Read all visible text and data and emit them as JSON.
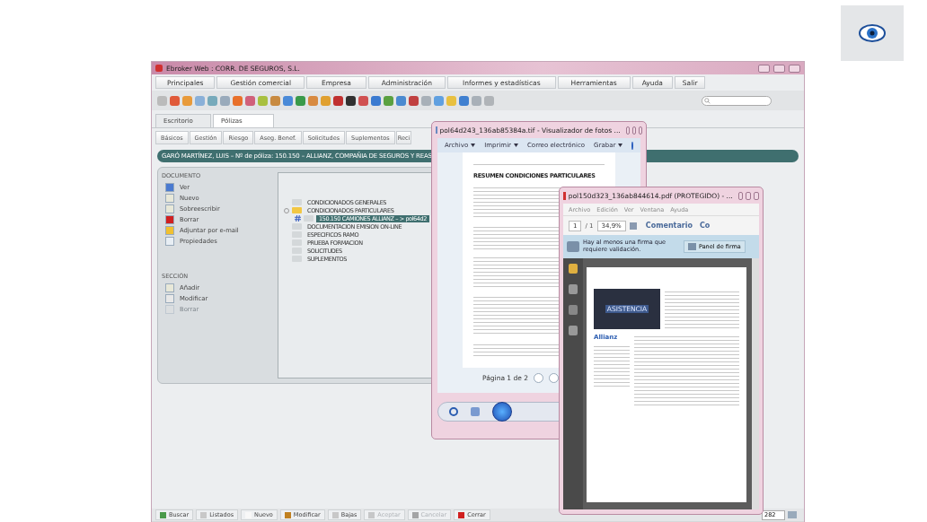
{
  "main_window": {
    "title": "Ebroker Web : CORR. DE SEGUROS, S.L.",
    "menu": [
      "Principales",
      "Gestión comercial",
      "Empresa",
      "Administración",
      "Informes y estadísticas",
      "Herramientas",
      "Ayuda",
      "Salir"
    ],
    "tabs": [
      {
        "label": "Escritorio",
        "selected": false
      },
      {
        "label": "Pólizas",
        "selected": true
      }
    ],
    "subtabs": [
      {
        "label": "Básicos",
        "selected": false
      },
      {
        "label": "Gestión",
        "selected": false
      },
      {
        "label": "Riesgo",
        "selected": false
      },
      {
        "label": "Aseg. Benef.",
        "selected": false
      },
      {
        "label": "Solicitudes",
        "selected": false
      },
      {
        "label": "Suplementos",
        "selected": false
      },
      {
        "label": "Reci",
        "selected": false
      }
    ],
    "header": "GARÓ MARTÍNEZ, LUIS – Nº de póliza: 150.150 – ALLIANZ, COMPAÑIA DE SEGUROS Y REAS",
    "documento": {
      "title": "DOCUMENTO",
      "actions": [
        {
          "label": "Ver",
          "disabled": false
        },
        {
          "label": "Nuevo",
          "disabled": false
        },
        {
          "label": "Sobreescribir",
          "disabled": false
        },
        {
          "label": "Borrar",
          "disabled": false
        },
        {
          "label": "Adjuntar por e-mail",
          "disabled": false
        },
        {
          "label": "Propiedades",
          "disabled": false
        }
      ]
    },
    "seccion": {
      "title": "SECCIÓN",
      "actions": [
        {
          "label": "Añadir",
          "disabled": false
        },
        {
          "label": "Modificar",
          "disabled": false
        },
        {
          "label": "Borrar",
          "disabled": true
        }
      ]
    },
    "tree": [
      {
        "label": "CONDICIONADOS GENERALES",
        "selected": false
      },
      {
        "label": "CONDICIONADOS PARTICULARES",
        "selected": false,
        "expanded": true,
        "children": [
          {
            "label": "150.150 CAMIONES ALLIANZ – > pol64d2",
            "selected": true
          }
        ]
      },
      {
        "label": "DOCUMENTACION EMISION ON-LINE",
        "selected": false
      },
      {
        "label": "ESPECIFICOS RAMO",
        "selected": false
      },
      {
        "label": "PRUEBA FORMACION",
        "selected": false
      },
      {
        "label": "SOLICITUDES",
        "selected": false
      },
      {
        "label": "SUPLEMENTOS",
        "selected": false
      }
    ],
    "bottom_toolbar": [
      {
        "label": "Buscar",
        "disabled": false
      },
      {
        "label": "Listados",
        "disabled": false
      },
      {
        "label": "Nuevo",
        "disabled": false
      },
      {
        "label": "Modificar",
        "disabled": false
      },
      {
        "label": "Bajas",
        "disabled": false
      },
      {
        "label": "Aceptar",
        "disabled": true
      },
      {
        "label": "Cancelar",
        "disabled": true
      },
      {
        "label": "Cerrar",
        "disabled": false
      }
    ],
    "record_count": "282"
  },
  "photo_viewer": {
    "title": "pol64d243_136ab85384a.tif - Visualizador de fotos ...",
    "menu": [
      {
        "label": "Archivo",
        "dropdown": true
      },
      {
        "label": "Imprimir",
        "dropdown": true
      },
      {
        "label": "Correo electrónico",
        "dropdown": false
      },
      {
        "label": "Grabar",
        "dropdown": true
      }
    ],
    "page_heading": "RESUMEN CONDICIONES PARTICULARES",
    "pager": "Página 1 de 2"
  },
  "pdf_viewer": {
    "title": "pol150d323_136ab844614.pdf (PROTEGIDO) - ...",
    "menu": [
      "Archivo",
      "Edición",
      "Ver",
      "Ventana",
      "Ayuda"
    ],
    "page": "1",
    "page_total": "/ 1",
    "zoom": "34,9%",
    "toolbar_links": [
      "Comentario",
      "Co"
    ],
    "notice": "Hay al menos una firma que requiere validación.",
    "sign_panel": "Panel de firma",
    "page_texts": [
      "ASISTENCIA",
      "Allianz"
    ]
  }
}
